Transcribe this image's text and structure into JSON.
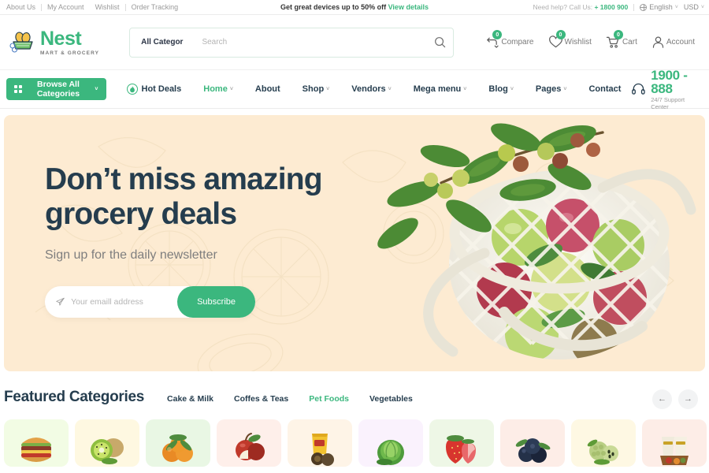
{
  "topbar": {
    "links": [
      "About Us",
      "My Account",
      "Wishlist",
      "Order Tracking"
    ],
    "promo_text": "Get great devices up to 50% off ",
    "promo_link": "View details",
    "need_help_label": "Need help? Call Us:",
    "need_help_phone": "+ 1800 900",
    "language": "English",
    "currency": "USD",
    "caret": "˅"
  },
  "header": {
    "logo_name": "Nest",
    "logo_sub": "MART & GROCERY",
    "search": {
      "category": "All Categor",
      "placeholder": "Search",
      "value": ""
    },
    "actions": [
      {
        "label": "Compare",
        "count": "0",
        "icon": "compare-icon"
      },
      {
        "label": "Wishlist",
        "count": "0",
        "icon": "heart-icon"
      },
      {
        "label": "Cart",
        "count": "0",
        "icon": "cart-icon"
      },
      {
        "label": "Account",
        "count": "",
        "icon": "user-icon"
      }
    ]
  },
  "nav": {
    "browse_label": "Browse All Categories",
    "browse_caret": "˅",
    "hot_deals": "Hot Deals",
    "items": [
      {
        "label": "Home",
        "caret": "˅",
        "active": true
      },
      {
        "label": "About",
        "caret": "",
        "active": false
      },
      {
        "label": "Shop",
        "caret": "˅",
        "active": false
      },
      {
        "label": "Vendors",
        "caret": "˅",
        "active": false
      },
      {
        "label": "Mega menu",
        "caret": "˅",
        "active": false
      },
      {
        "label": "Blog",
        "caret": "˅",
        "active": false
      },
      {
        "label": "Pages",
        "caret": "˅",
        "active": false
      },
      {
        "label": "Contact",
        "caret": "",
        "active": false
      }
    ],
    "support_phone": "1900 - 888",
    "support_label": "24/7 Support Center"
  },
  "hero": {
    "headline_line1": "Don’t miss amazing",
    "headline_line2": "grocery deals",
    "tagline": "Sign up for the daily newsletter",
    "email_placeholder": "Your emaill address",
    "email_value": "",
    "subscribe_label": "Subscribe",
    "bg_color": "#FDEBD2"
  },
  "featured": {
    "title": "Featured Categories",
    "tabs": [
      {
        "label": "Cake & Milk",
        "active": false
      },
      {
        "label": "Coffes & Teas",
        "active": false
      },
      {
        "label": "Pet Foods",
        "active": true
      },
      {
        "label": "Vegetables",
        "active": false
      }
    ],
    "prev_arrow": "←",
    "next_arrow": "→",
    "cards": [
      {
        "name": "burger",
        "bg": "#F2FCE4"
      },
      {
        "name": "kiwi",
        "bg": "#FEF8E1"
      },
      {
        "name": "persimmon",
        "bg": "#E9F7E4"
      },
      {
        "name": "apple",
        "bg": "#FEEFEA"
      },
      {
        "name": "snack-pack",
        "bg": "#FEF4E7"
      },
      {
        "name": "cabbage",
        "bg": "#FAF2FD"
      },
      {
        "name": "strawberry",
        "bg": "#EEF7E6"
      },
      {
        "name": "blueberry",
        "bg": "#FDEDE7"
      },
      {
        "name": "custard-apple",
        "bg": "#FEF8E3"
      },
      {
        "name": "packaged-goods",
        "bg": "#FDEDE7"
      }
    ]
  },
  "colors": {
    "accent_green": "#3BB77E",
    "dark_navy": "#253D4E",
    "hero_cream": "#FDEBD2"
  }
}
